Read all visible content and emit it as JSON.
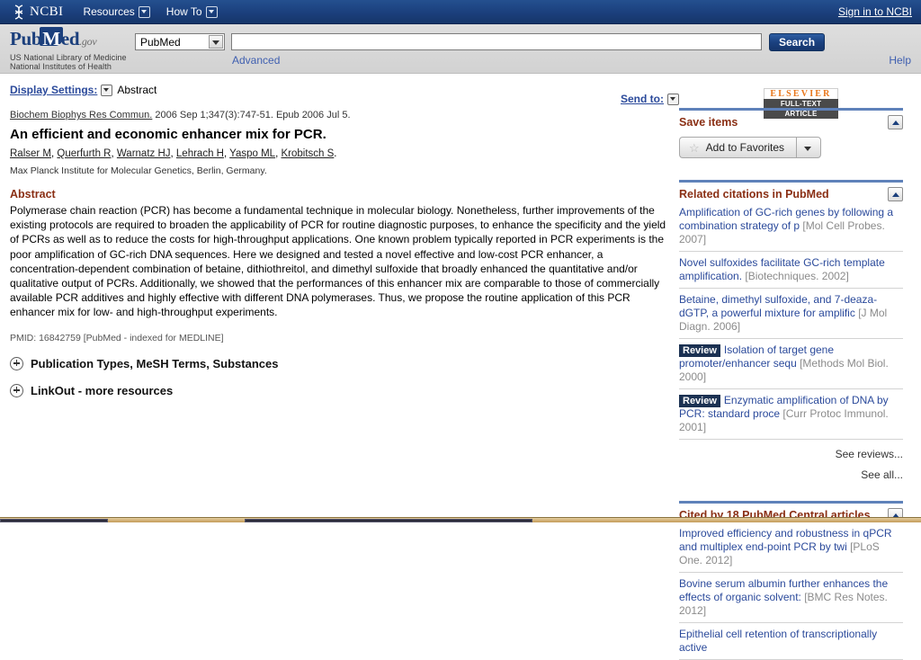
{
  "topbar": {
    "logo_text": "NCBI",
    "logo_icon": "dna-helix-icon",
    "menu": [
      {
        "label": "Resources",
        "icon": "chevron-down-icon"
      },
      {
        "label": "How To",
        "icon": "chevron-down-icon"
      }
    ],
    "signin_label": "Sign in to NCBI"
  },
  "header": {
    "logo_part1": "Pub",
    "logo_part2": "M",
    "logo_part3": "ed",
    "logo_gov": ".gov",
    "subtitle_line1": "US National Library of Medicine",
    "subtitle_line2": "National Institutes of Health",
    "database_selected": "PubMed",
    "database_options": [
      "PubMed"
    ],
    "search_value": "",
    "search_placeholder": "",
    "search_button": "Search",
    "advanced_link": "Advanced",
    "help_link": "Help"
  },
  "toolbar": {
    "display_settings_label": "Display Settings:",
    "display_settings_value": "Abstract",
    "send_to_label": "Send to:"
  },
  "publisher_badge": {
    "name": "ELSEVIER",
    "subtitle": "FULL-TEXT ARTICLE"
  },
  "article": {
    "journal": "Biochem Biophys Res Commun.",
    "citation": " 2006 Sep 1;347(3):747-51. Epub 2006 Jul 5.",
    "title": "An efficient and economic enhancer mix for PCR.",
    "authors": [
      "Ralser M",
      "Querfurth R",
      "Warnatz HJ",
      "Lehrach H",
      "Yaspo ML",
      "Krobitsch S"
    ],
    "affiliation": "Max Planck Institute for Molecular Genetics, Berlin, Germany.",
    "abstract_heading": "Abstract",
    "abstract_text": "Polymerase chain reaction (PCR) has become a fundamental technique in molecular biology. Nonetheless, further improvements of the existing protocols are required to broaden the applicability of PCR for routine diagnostic purposes, to enhance the specificity and the yield of PCRs as well as to reduce the costs for high-throughput applications. One known problem typically reported in PCR experiments is the poor amplification of GC-rich DNA sequences. Here we designed and tested a novel effective and low-cost PCR enhancer, a concentration-dependent combination of betaine, dithiothreitol, and dimethyl sulfoxide that broadly enhanced the quantitative and/or qualitative output of PCRs. Additionally, we showed that the performances of this enhancer mix are comparable to those of commercially available PCR additives and highly effective with different DNA polymerases. Thus, we propose the routine application of this PCR enhancer mix for low- and high-throughput experiments.",
    "pmid_line": "PMID: 16842759 [PubMed - indexed for MEDLINE]",
    "expand_sections": [
      "Publication Types, MeSH Terms, Substances",
      "LinkOut - more resources"
    ]
  },
  "sidebar": {
    "save_items": {
      "title": "Save items",
      "favorites_button": "Add to Favorites",
      "star_icon": "star-icon"
    },
    "related": {
      "title": "Related citations in PubMed",
      "items": [
        {
          "badge": "",
          "text": "Amplification of GC-rich genes by following a combination strategy of p",
          "source": "[Mol Cell Probes. 2007]"
        },
        {
          "badge": "",
          "text": "Novel sulfoxides facilitate GC-rich template amplification.",
          "source": "[Biotechniques. 2002]"
        },
        {
          "badge": "",
          "text": "Betaine, dimethyl sulfoxide, and 7-deaza-dGTP, a powerful mixture for amplific",
          "source": "[J Mol Diagn. 2006]"
        },
        {
          "badge": "Review",
          "text": "Isolation of target gene promoter/enhancer sequ",
          "source": "[Methods Mol Biol. 2000]"
        },
        {
          "badge": "Review",
          "text": "Enzymatic amplification of DNA by PCR: standard proce",
          "source": "[Curr Protoc Immunol. 2001]"
        }
      ],
      "see_reviews": "See reviews...",
      "see_all": "See all..."
    },
    "cited_by": {
      "title": "Cited by 18 PubMed Central articles",
      "items": [
        {
          "text": "Improved efficiency and robustness in qPCR and multiplex end-point PCR by twi",
          "source": "[PLoS One. 2012]"
        },
        {
          "text": "Bovine serum albumin further enhances the effects of organic solvent:",
          "source": "[BMC Res Notes. 2012]"
        },
        {
          "text": "Epithelial cell retention of transcriptionally active",
          "source": ""
        }
      ]
    }
  }
}
